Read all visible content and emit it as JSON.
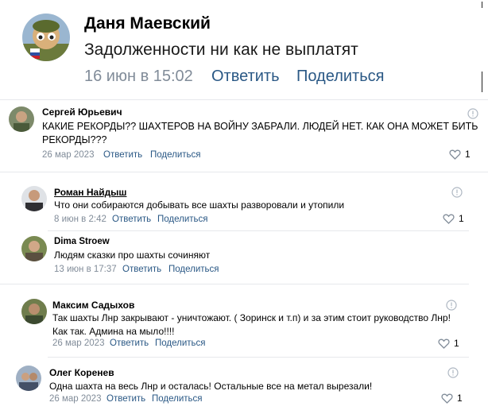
{
  "post": {
    "author": "Даня Маевский",
    "text": "Задолженности ни как не выплатят",
    "date": "16 июн в 15:02",
    "reply": "Ответить",
    "share": "Поделиться"
  },
  "comments": [
    {
      "author": "Сергей Юрьевич",
      "text_line1": "КАКИЕ РЕКОРДЫ?? ШАХТЕРОВ НА ВОЙНУ ЗАБРАЛИ. ЛЮДЕЙ НЕТ. КАК ОНА МОЖЕТ БИТЬ",
      "text_line2": "РЕКОРДЫ???",
      "date": "26 мар 2023",
      "reply": "Ответить",
      "share": "Поделиться",
      "likes": "1"
    },
    {
      "author": "Роман Найдыш",
      "text_line1": "Что они собираются добывать все шахты разворовали и утопили",
      "date": "8 июн в 2:42",
      "reply": "Ответить",
      "share": "Поделиться",
      "likes": "1"
    },
    {
      "author": "Dima Stroew",
      "text_line1": "Людям сказки про шахты сочиняют",
      "date": "13 июн в 17:37",
      "reply": "Ответить",
      "share": "Поделиться"
    },
    {
      "author": "Максим Садыхов",
      "text_line1": "Так шахты Лнр закрывают - уничтожают. ( Зоринск и т.п) и за этим стоит руководство Лнр!",
      "text_line2": "Как так. Админа на мыло!!!!",
      "date": "26 мар 2023",
      "reply": "Ответить",
      "share": "Поделиться",
      "likes": "1"
    },
    {
      "author": "Олег Коренев",
      "text_line1": "Одна шахта на весь Лнр и осталась! Остальные все на метал вырезали!",
      "date": "26 мар 2023",
      "reply": "Ответить",
      "share": "Поделиться",
      "likes": "1"
    }
  ],
  "colors": {
    "link": "#2a5885",
    "meta": "#818c99",
    "separator": "#e7e8ec"
  }
}
